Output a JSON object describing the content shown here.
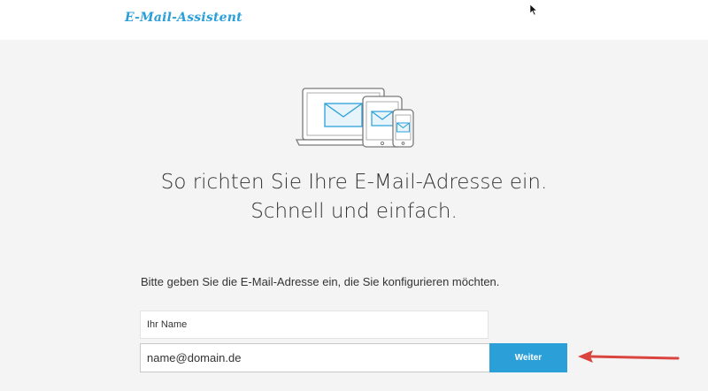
{
  "header": {
    "logo_text": "E-Mail-Assistent"
  },
  "icons": {
    "devices": "laptop-tablet-phone-mail-icon",
    "cursor": "mouse-cursor-icon",
    "arrow": "red-arrow-left-icon"
  },
  "main": {
    "headline_line1": "So richten Sie Ihre E-Mail-Adresse ein.",
    "headline_line2": "Schnell und einfach.",
    "instruction": "Bitte geben Sie die E-Mail-Adresse ein, die Sie konfigurieren möchten."
  },
  "form": {
    "name_placeholder": "Ihr Name",
    "name_value": "",
    "email_value": "name@domain.de",
    "submit_label": "Weiter"
  },
  "colors": {
    "accent": "#2a9fd8",
    "arrow": "#d9443f",
    "background": "#f4f4f4"
  }
}
